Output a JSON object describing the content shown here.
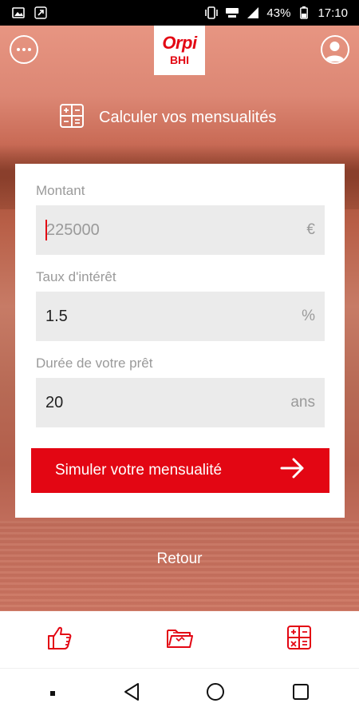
{
  "status_bar": {
    "battery": "43%",
    "time": "17:10",
    "icons": [
      "image-icon",
      "bolt-swap-icon",
      "vibrate-icon",
      "wifi-4g-icon",
      "signal-icon",
      "battery-icon"
    ]
  },
  "header": {
    "logo_main": "Orpi",
    "logo_sub": "BHI",
    "title": "Calculer vos mensualités"
  },
  "form": {
    "amount": {
      "label": "Montant",
      "placeholder": "225000",
      "unit": "€"
    },
    "rate": {
      "label": "Taux d'intérêt",
      "value": "1.5",
      "unit": "%"
    },
    "duration": {
      "label": "Durée de votre prêt",
      "value": "20",
      "unit": "ans"
    },
    "submit_label": "Simuler votre mensualité"
  },
  "back_label": "Retour",
  "bottom_tabs": [
    {
      "icon": "thumbs-up-icon"
    },
    {
      "icon": "folder-icon"
    },
    {
      "icon": "calculator-icon"
    }
  ],
  "colors": {
    "brand_red": "#e30613",
    "field_bg": "#ebebeb",
    "label_gray": "#9a9a9a"
  }
}
